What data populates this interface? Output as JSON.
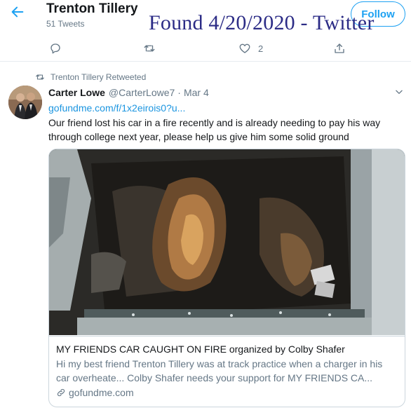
{
  "header": {
    "name": "Trenton Tillery",
    "tweet_count": "51 Tweets",
    "follow_label": "Follow",
    "overlay_note": "Found 4/20/2020 - Twitter"
  },
  "actions": {
    "reply_count": "",
    "retweet_count": "",
    "like_count": "2",
    "share_count": ""
  },
  "retweet_notice": "Trenton Tillery Retweeted",
  "tweet": {
    "author_name": "Carter Lowe",
    "author_handle": "@CarterLowe7",
    "separator": "·",
    "date": "Mar 4",
    "link": "gofundme.com/f/1x2eirois0?u...",
    "text": "Our friend lost his car in a fire recently and is already needing to pay his way through college next year, please help us give him some solid ground"
  },
  "card": {
    "title": "MY FRIENDS CAR CAUGHT ON FIRE organized by Colby Shafer",
    "description": "Hi my best friend Trenton Tillery was at track practice when a charger in his car overheate... Colby Shafer needs your support for MY FRIENDS CA...",
    "domain": "gofundme.com"
  },
  "icons": {
    "back": "back-arrow-icon",
    "reply": "reply-icon",
    "retweet": "retweet-icon",
    "like": "heart-icon",
    "share": "share-icon",
    "retweeted": "retweet-icon",
    "caret": "chevron-down-icon",
    "link": "link-icon"
  },
  "colors": {
    "accent": "#1da1f2",
    "link": "#1b95e0",
    "muted": "#657786",
    "overlay_text": "#2c2c86"
  }
}
